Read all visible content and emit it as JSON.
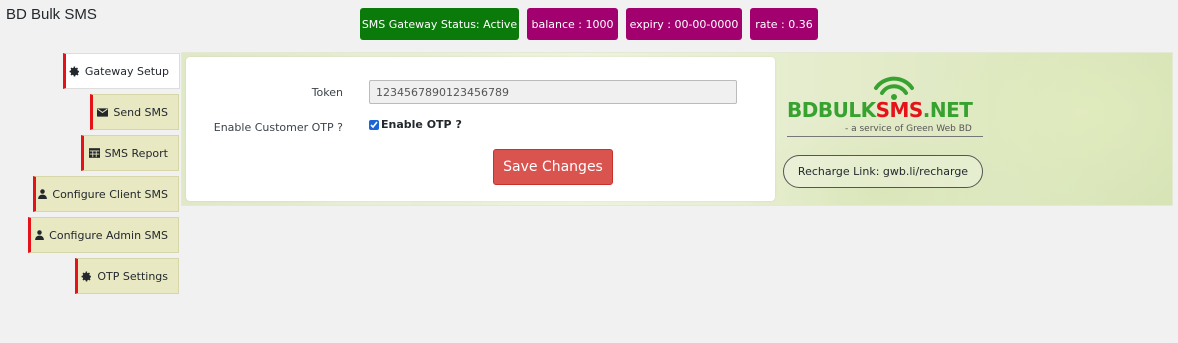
{
  "page": {
    "title": "BD Bulk SMS"
  },
  "status_badges": {
    "status": "SMS Gateway Status: Active",
    "balance": "balance : 1000",
    "expiry": "expiry : 00-00-0000",
    "rate": "rate : 0.36"
  },
  "tabs": [
    {
      "label": "Gateway Setup",
      "icon": "gear-icon",
      "active": true
    },
    {
      "label": "Send SMS",
      "icon": "envelope-icon",
      "active": false
    },
    {
      "label": "SMS Report",
      "icon": "table-icon",
      "active": false
    },
    {
      "label": "Configure Client SMS",
      "icon": "user-icon",
      "active": false
    },
    {
      "label": "Configure Admin SMS",
      "icon": "user-icon",
      "active": false
    },
    {
      "label": "OTP Settings",
      "icon": "gear-icon",
      "active": false
    }
  ],
  "form": {
    "token_label": "Token",
    "token_value": "1234567890123456789",
    "otp_label": "Enable Customer OTP ?",
    "otp_checkbox_label": "Enable OTP ?",
    "otp_checked": true,
    "save_label": "Save Changes"
  },
  "brand": {
    "logo_part1": "BDBULK",
    "logo_part2": "SMS",
    "logo_part3": ".NET",
    "tagline": "- a service of Green Web BD",
    "recharge_label": "Recharge Link: gwb.li/recharge"
  },
  "colors": {
    "active_status": "#0a7a0a",
    "badge": "#a3006f",
    "tab_accent": "#e5121a",
    "save_button": "#d9534f",
    "logo_green": "#37a22f",
    "logo_red": "#e5121a"
  }
}
